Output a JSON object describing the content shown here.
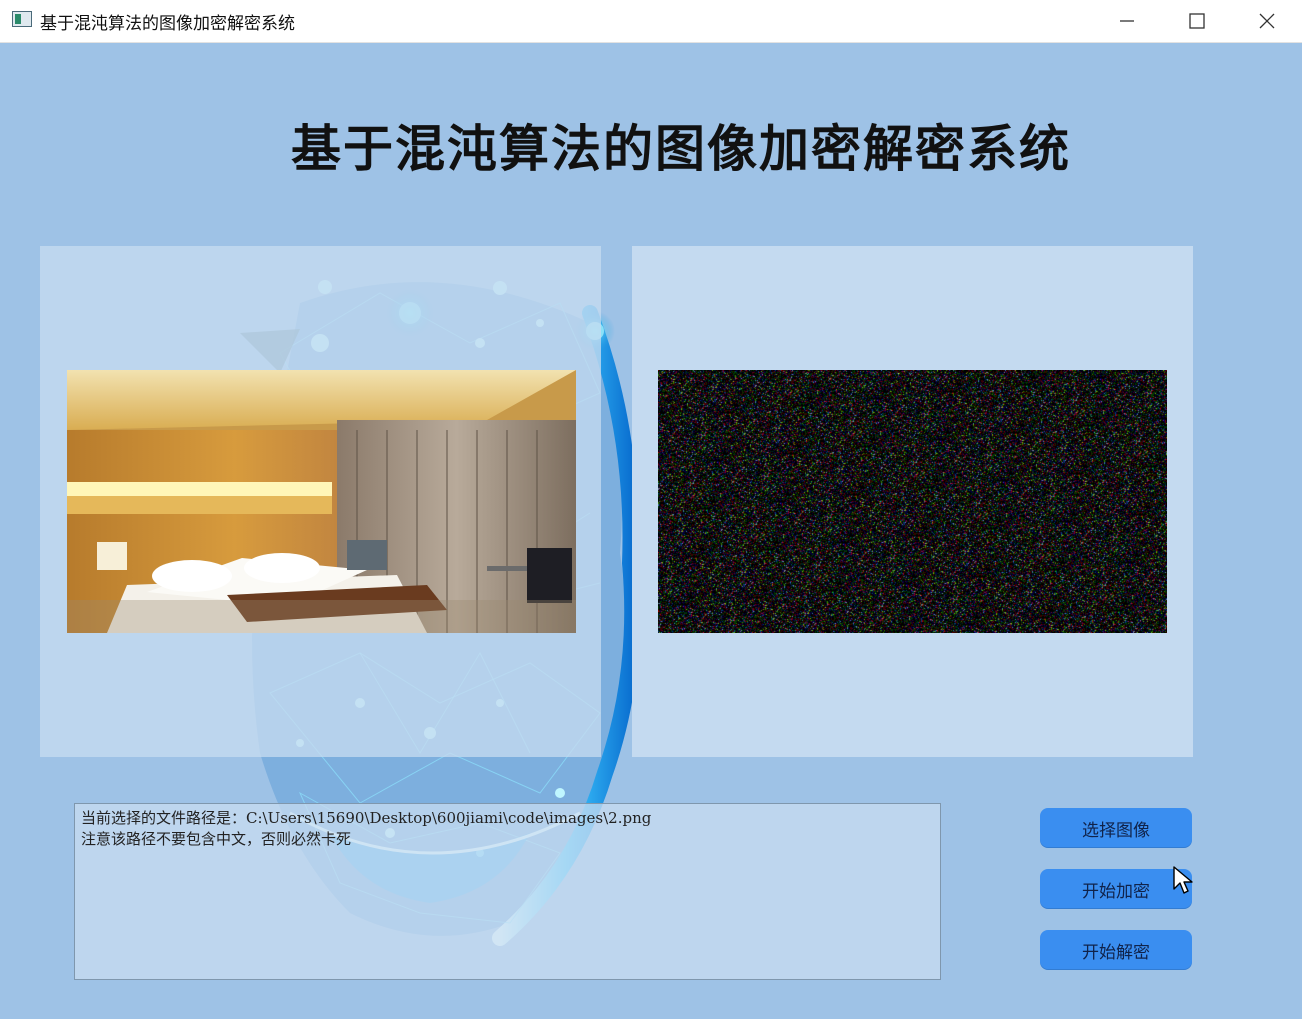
{
  "window": {
    "title": "基于混沌算法的图像加密解密系统",
    "icons": [
      "app-icon",
      "minimize-icon",
      "maximize-icon",
      "close-icon"
    ]
  },
  "main": {
    "title": "基于混沌算法的图像加密解密系统"
  },
  "images": {
    "original_alt": "hotel-room-photo",
    "encrypted_alt": "encrypted-noise-image"
  },
  "log": {
    "lines": [
      "当前选择的文件路径是：C:\\Users\\15690\\Desktop\\600jiami\\code\\images\\2.png",
      "注意该路径不要包含中文，否则必然卡死"
    ]
  },
  "buttons": {
    "select_label": "选择图像",
    "encrypt_label": "开始加密",
    "decrypt_label": "开始解密"
  },
  "colors": {
    "background": "#9ec2e6",
    "panel": "#c4daf0",
    "button": "#3a8ef0"
  }
}
